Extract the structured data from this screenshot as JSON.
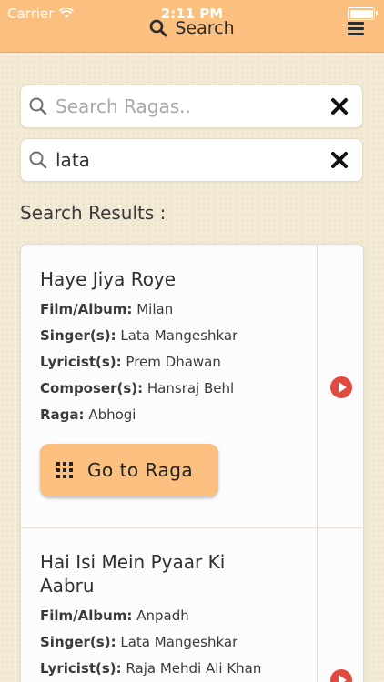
{
  "status_bar": {
    "carrier": "Carrier",
    "time": "2:11 PM"
  },
  "navbar": {
    "title": "Search"
  },
  "raga_search": {
    "placeholder": "Search Ragas..",
    "value": ""
  },
  "song_search": {
    "placeholder": "",
    "value": "lata"
  },
  "results_heading": "Search Results :",
  "labels": {
    "film": "Film/Album:",
    "singer": "Singer(s):",
    "lyricist": "Lyricist(s):",
    "composer": "Composer(s):",
    "raga": "Raga:",
    "goto_button": "Go to Raga"
  },
  "results": [
    {
      "title": "Haye Jiya Roye",
      "film": "Milan",
      "singer": "Lata Mangeshkar",
      "lyricist": "Prem Dhawan",
      "composer": "Hansraj Behl",
      "raga": "Abhogi"
    },
    {
      "title_line1": "Hai Isi Mein Pyaar Ki",
      "title_line2": "Aabru",
      "film": "Anpadh",
      "singer": "Lata Mangeshkar",
      "lyricist": "Raja Mehdi Ali Khan"
    }
  ],
  "colors": {
    "accent": "#fbbf80",
    "play": "#e14a3d",
    "background": "#f3ead6"
  }
}
